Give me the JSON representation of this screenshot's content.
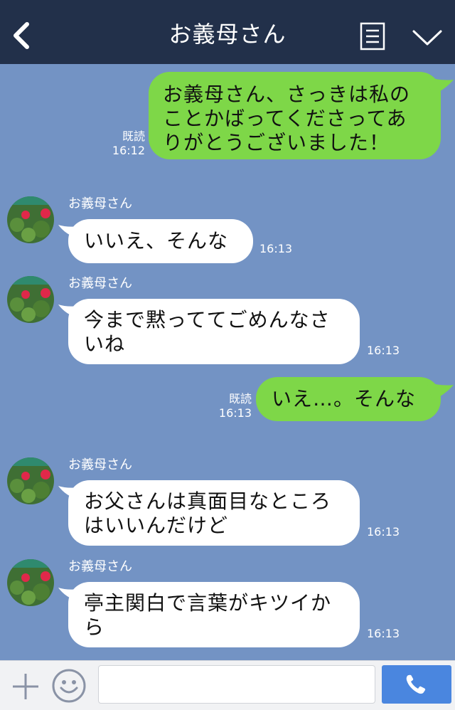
{
  "header": {
    "title": "お義母さん"
  },
  "messages": [
    {
      "sender_side": "me",
      "lines": [
        "お義母さん、さっきは私の",
        "ことかばってくださってあ",
        "りがとうございました！"
      ],
      "read_label": "既読",
      "time": "16:12"
    },
    {
      "sender_side": "them",
      "sender_name": "お義母さん",
      "lines": [
        "いいえ、そんな"
      ],
      "time": "16:13"
    },
    {
      "sender_side": "them",
      "sender_name": "お義母さん",
      "lines": [
        "今まで黙っててごめんなさ",
        "いね"
      ],
      "time": "16:13"
    },
    {
      "sender_side": "me",
      "lines": [
        "いえ…。そんな"
      ],
      "read_label": "既読",
      "time": "16:13"
    },
    {
      "sender_side": "them",
      "sender_name": "お義母さん",
      "lines": [
        "お父さんは真面目なところ",
        "はいいんだけど"
      ],
      "time": "16:13"
    },
    {
      "sender_side": "them",
      "sender_name": "お義母さん",
      "lines": [
        "亭主関白で言葉がキツイか",
        "ら"
      ],
      "time": "16:13"
    }
  ],
  "input": {
    "value": "",
    "placeholder": ""
  },
  "colors": {
    "background": "#7393c4",
    "header": "#22304a",
    "my_bubble": "#7ed748",
    "their_bubble": "#ffffff",
    "call_button": "#4a86df"
  },
  "icons": {
    "back": "chevron-left-icon",
    "notes": "notes-icon",
    "menu": "chevron-down-icon",
    "plus": "plus-icon",
    "emoji": "smiley-icon",
    "call": "phone-icon"
  }
}
